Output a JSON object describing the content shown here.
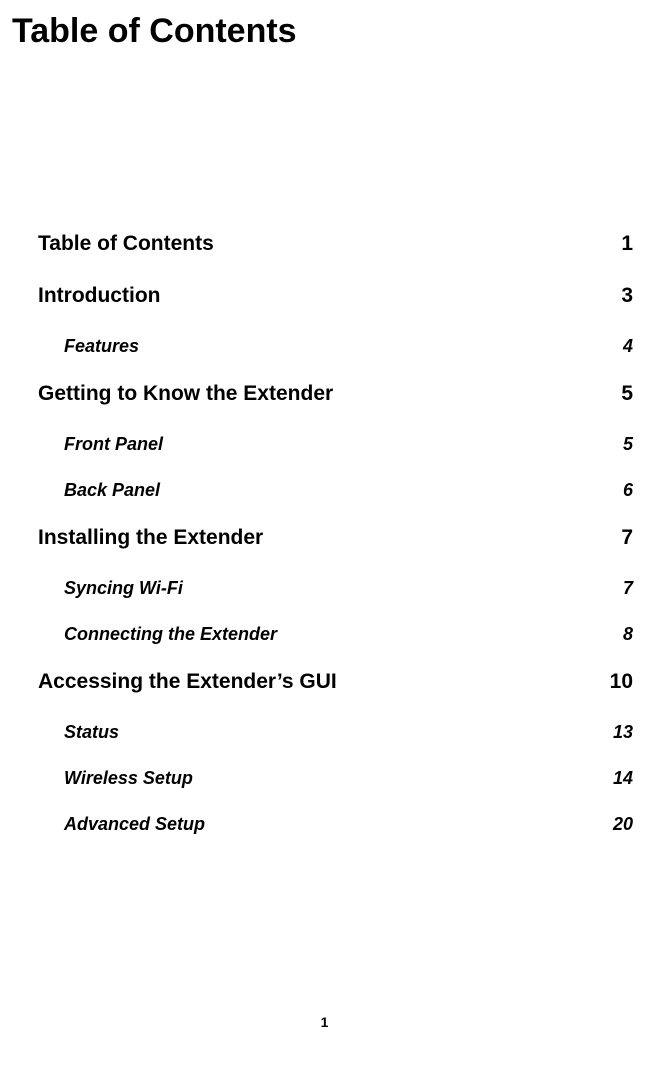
{
  "title": "Table of Contents",
  "page_number": "1",
  "toc": [
    {
      "label": "Table of Contents",
      "page": "1",
      "subs": []
    },
    {
      "label": "Introduction",
      "page": "3",
      "subs": [
        {
          "label": "Features",
          "page": "4"
        }
      ]
    },
    {
      "label": "Getting to Know the Extender",
      "page": "5",
      "subs": [
        {
          "label": "Front Panel",
          "page": "5"
        },
        {
          "label": "Back Panel",
          "page": "6"
        }
      ]
    },
    {
      "label": "Installing the Extender",
      "page": "7",
      "subs": [
        {
          "label": "Syncing Wi-Fi",
          "page": "7"
        },
        {
          "label": "Connecting the Extender",
          "page": "8"
        }
      ]
    },
    {
      "label": "Accessing the Extender’s GUI",
      "page": "10",
      "subs": [
        {
          "label": "Status",
          "page": "13"
        },
        {
          "label": "Wireless Setup",
          "page": "14"
        },
        {
          "label": "Advanced Setup",
          "page": "20"
        }
      ]
    }
  ]
}
